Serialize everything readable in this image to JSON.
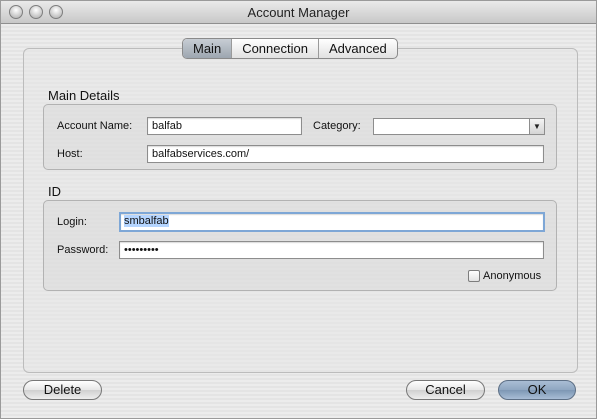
{
  "window": {
    "title": "Account Manager"
  },
  "tabs": [
    {
      "label": "Main",
      "active": true
    },
    {
      "label": "Connection",
      "active": false
    },
    {
      "label": "Advanced",
      "active": false
    }
  ],
  "main_details": {
    "group_label": "Main Details",
    "account_name_label": "Account Name:",
    "account_name_value": "balfab",
    "category_label": "Category:",
    "category_value": "",
    "host_label": "Host:",
    "host_value": "balfabservices.com/"
  },
  "id_group": {
    "group_label": "ID",
    "login_label": "Login:",
    "login_value": "smbalfab",
    "password_label": "Password:",
    "password_value": "•••••••••",
    "anonymous_label": "Anonymous",
    "anonymous_checked": false
  },
  "buttons": {
    "delete": "Delete",
    "cancel": "Cancel",
    "ok": "OK"
  },
  "colors": {
    "selection_highlight": "#b5d5ff",
    "focus_ring": "#7ea7d6",
    "default_button": "#8ea6c1"
  },
  "icons": {
    "close": "traffic-light-close-icon",
    "minimize": "traffic-light-minimize-icon",
    "zoom": "traffic-light-zoom-icon",
    "popup_arrow": "chevron-down-icon"
  }
}
